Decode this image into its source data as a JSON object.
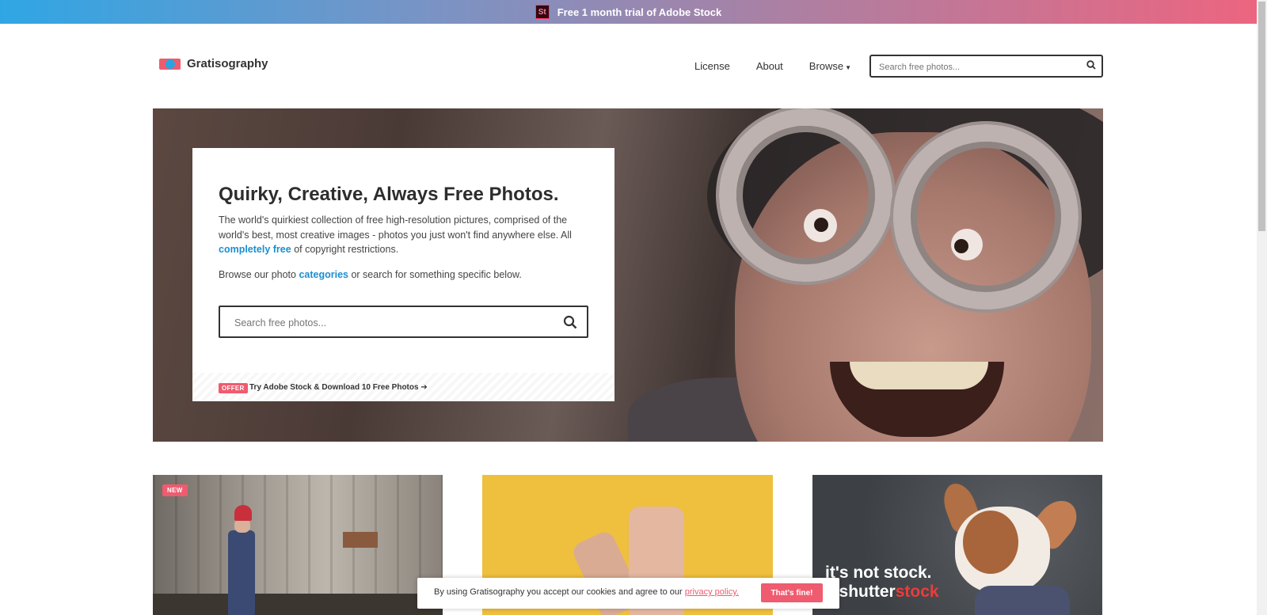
{
  "promo": {
    "logo_text": "St",
    "text": "Free 1 month trial of Adobe Stock"
  },
  "header": {
    "brand": "Gratisography",
    "nav": {
      "license": "License",
      "about": "About",
      "browse": "Browse"
    },
    "search_placeholder": "Search free photos..."
  },
  "hero": {
    "title": "Quirky, Creative, Always Free Photos.",
    "desc_before": "The world's quirkiest collection of free high-resolution pictures, comprised of the world's best, most creative images - photos you just won't find anywhere else. All ",
    "desc_link": "completely free",
    "desc_after": " of copyright restrictions.",
    "browse_before": "Browse our photo ",
    "browse_link": "categories",
    "browse_after": " or search for something specific below.",
    "search_placeholder": "Search free photos...",
    "offer_badge": "OFFER",
    "offer_text": "Try Adobe Stock & Download 10 Free Photos ➔"
  },
  "gallery": {
    "tile1_badge": "NEW",
    "tile3_line1": "it's not stock.",
    "tile3_line2_a": "s shutter",
    "tile3_line2_b": "stock"
  },
  "cookie": {
    "text_before": "By using Gratisography you accept our cookies and agree to our ",
    "link": "privacy policy.",
    "button": "That's fine!"
  },
  "colors": {
    "accent_pink": "#ef5b6f",
    "accent_blue": "#1a8fd0",
    "promo_gradient_start": "#2fa6e4",
    "promo_gradient_end": "#ec6580"
  }
}
